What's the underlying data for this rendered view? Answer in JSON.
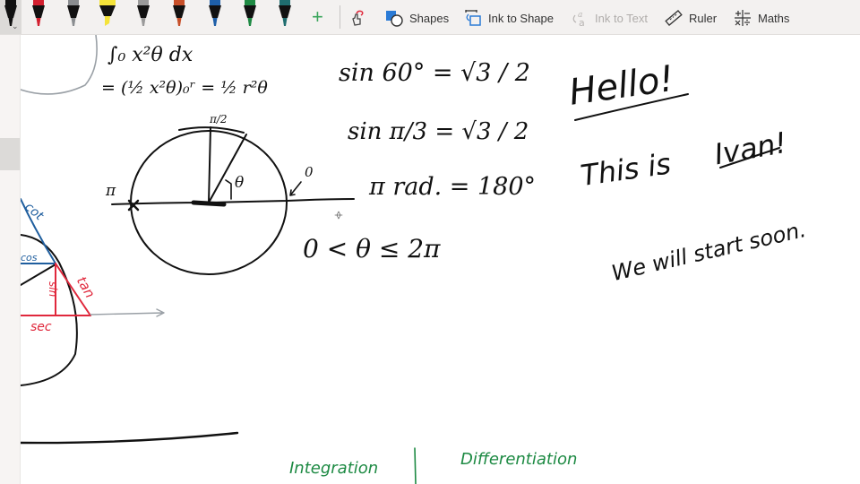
{
  "toolbar": {
    "pens": [
      {
        "name": "black-pen",
        "color": "#111111",
        "selected": true
      },
      {
        "name": "red-pen",
        "color": "#d32030"
      },
      {
        "name": "gray-pen",
        "color": "#8a8d90"
      },
      {
        "name": "yellow-highlighter",
        "color": "#f4e33a"
      },
      {
        "name": "galaxy-pen",
        "color": "#9a9a9a"
      },
      {
        "name": "rainbow-pen",
        "color": "#c7502a"
      },
      {
        "name": "blue-pen",
        "color": "#1e5fa8"
      },
      {
        "name": "green-pen",
        "color": "#1f8a44"
      },
      {
        "name": "teal-glitter-pen",
        "color": "#1f6d6f"
      }
    ],
    "add_pen_label": "+",
    "buttons": {
      "shapes": "Shapes",
      "ink_to_shape": "Ink to Shape",
      "ink_to_text": "Ink to Text",
      "ruler": "Ruler",
      "maths": "Maths"
    }
  },
  "canvas": {
    "ink_colors": {
      "black": "#111111",
      "blue": "#1f5e9e",
      "red": "#e0283c",
      "green": "#1d8a43",
      "gray": "#9aa0a6"
    },
    "equations": {
      "integral_fragment": "∫₀ x²θ dx",
      "integral_result": "= (½ x²θ)₀ʳ = ½ r²θ",
      "pi_over_2": "π/2",
      "pi_label": "π",
      "zero_label": "0",
      "theta_label": "θ",
      "sin60": "sin 60° = √3 / 2",
      "sin_pi3": "sin π/3 = √3 / 2",
      "pi_rad": "π rad. = 180°",
      "theta_range": "0 < θ ≤ 2π"
    },
    "trig_labels": {
      "cot": "cot",
      "cos": "cos",
      "sin": "sin",
      "tan": "tan",
      "sec": "sec"
    },
    "greeting": {
      "hello": "Hello!",
      "this_is": "This is",
      "name": "Ivan!",
      "start": "We will start soon."
    },
    "bottom": {
      "integration": "Integration",
      "differentiation": "Differentiation"
    }
  }
}
